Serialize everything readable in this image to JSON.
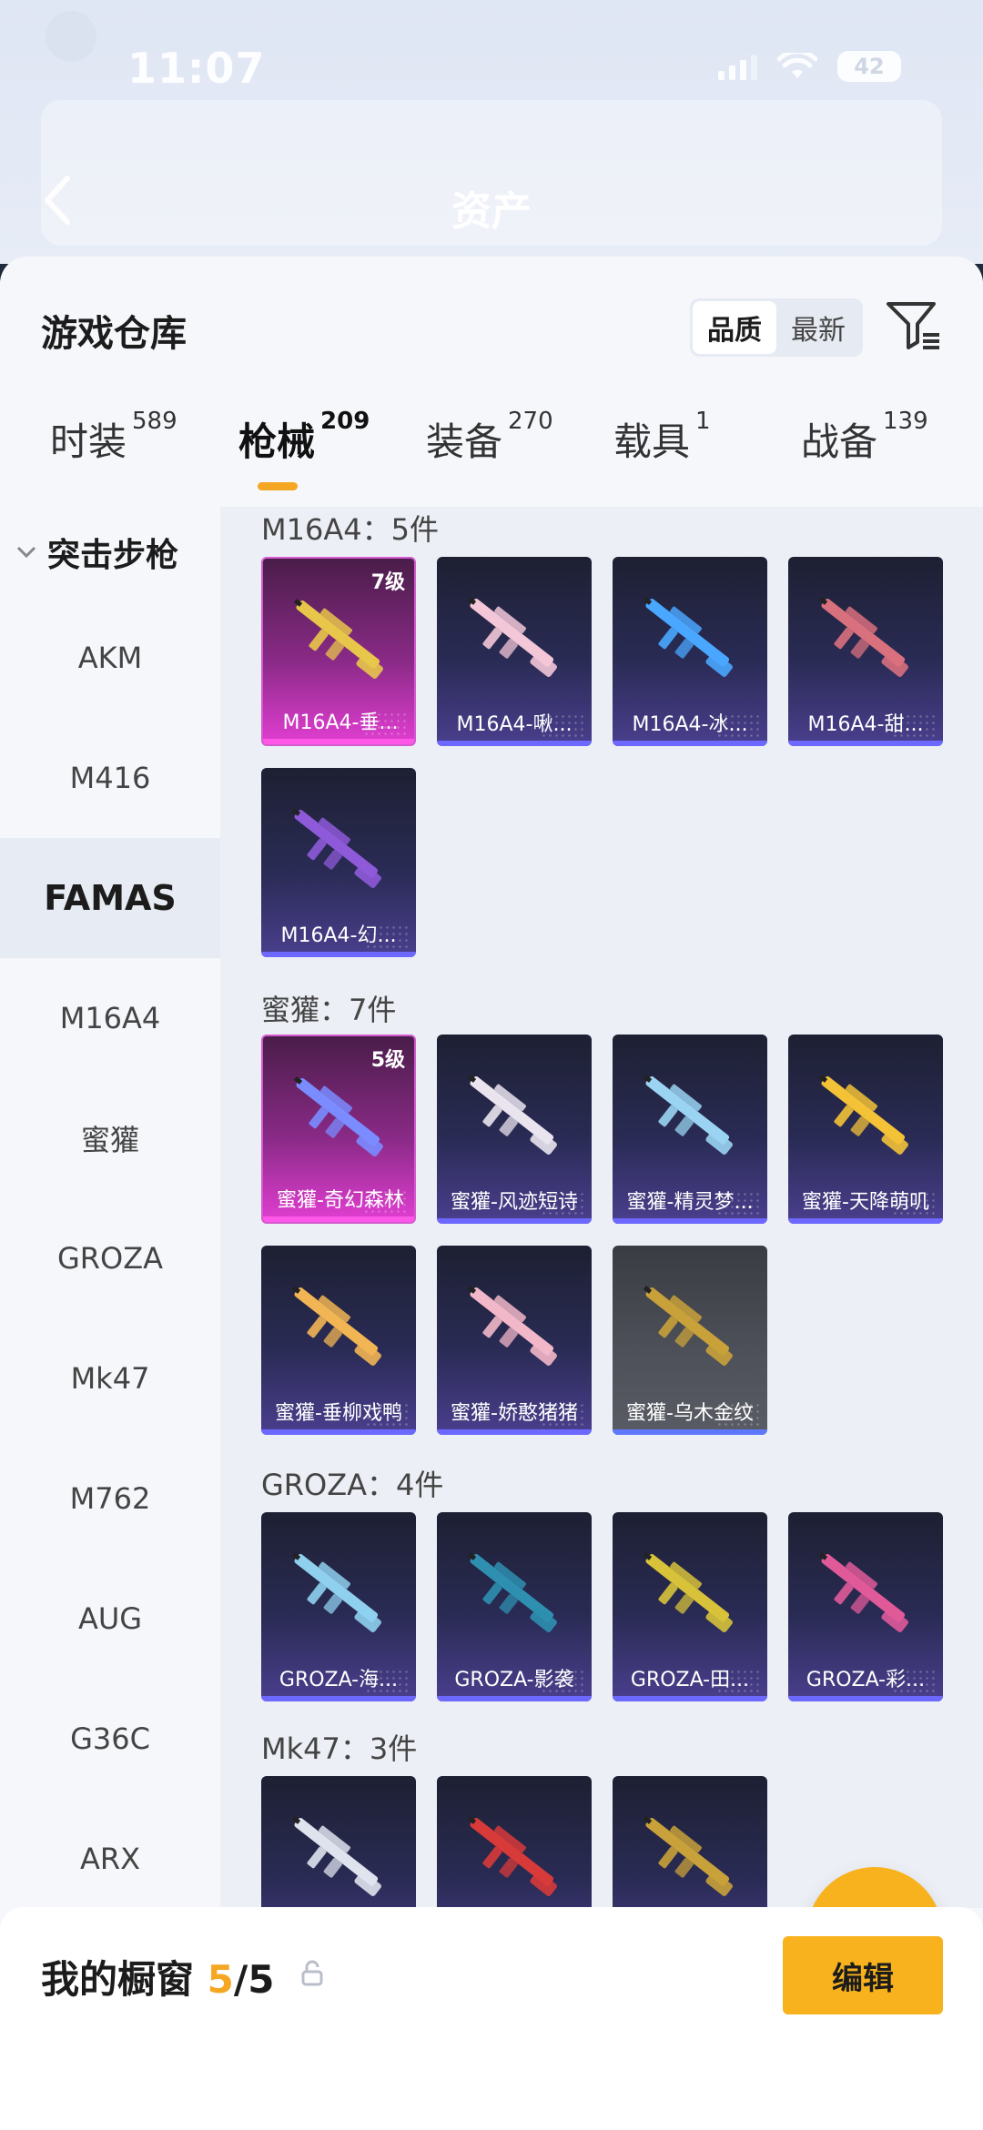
{
  "status": {
    "time": "11:07",
    "battery": "42"
  },
  "header": {
    "ghost_title": "资产"
  },
  "sheet": {
    "title": "游戏仓库",
    "sort_options": [
      "品质",
      "最新"
    ],
    "active_sort": "品质"
  },
  "tabs": [
    {
      "label": "时装",
      "count": "589"
    },
    {
      "label": "枪械",
      "count": "209"
    },
    {
      "label": "装备",
      "count": "270"
    },
    {
      "label": "载具",
      "count": "1"
    },
    {
      "label": "战备",
      "count": "139"
    }
  ],
  "active_tab": "枪械",
  "sidebar": {
    "group": "突击步枪",
    "items": [
      "AKM",
      "M416",
      "FAMAS",
      "M16A4",
      "蜜獾",
      "GROZA",
      "Mk47",
      "M762",
      "AUG",
      "G36C",
      "ARX"
    ],
    "active": "FAMAS"
  },
  "sections": [
    {
      "title": "M16A4：5件",
      "cards": [
        {
          "label": "M16A4-垂...",
          "level": "7级",
          "style": "pink",
          "gun_color": "#e8c64a"
        },
        {
          "label": "M16A4-啾...",
          "level": "",
          "style": "purple",
          "gun_color": "#f3c7d8"
        },
        {
          "label": "M16A4-冰...",
          "level": "",
          "style": "purple",
          "gun_color": "#4aa7ff"
        },
        {
          "label": "M16A4-甜...",
          "level": "",
          "style": "purple",
          "gun_color": "#d9707e"
        },
        {
          "label": "M16A4-幻...",
          "level": "",
          "style": "purple",
          "gun_color": "#8e5ad9"
        }
      ]
    },
    {
      "title": "蜜獾：7件",
      "cards": [
        {
          "label": "蜜獾-奇幻森林",
          "level": "5级",
          "style": "pink",
          "gun_color": "#7a8cff"
        },
        {
          "label": "蜜獾-风迹短诗",
          "level": "",
          "style": "purple",
          "gun_color": "#e9e4ee"
        },
        {
          "label": "蜜獾-精灵梦...",
          "level": "",
          "style": "purple",
          "gun_color": "#9ad4f2"
        },
        {
          "label": "蜜獾-天降萌叽",
          "level": "",
          "style": "purple",
          "gun_color": "#f3c237"
        },
        {
          "label": "蜜獾-垂柳戏鸭",
          "level": "",
          "style": "purple",
          "gun_color": "#f2b554"
        },
        {
          "label": "蜜獾-娇憨猪猪",
          "level": "",
          "style": "purple",
          "gun_color": "#f2b7c8"
        },
        {
          "label": "蜜獾-乌木金纹",
          "level": "",
          "style": "gray",
          "gun_color": "#c9a13a"
        }
      ]
    },
    {
      "title": "GROZA：4件",
      "cards": [
        {
          "label": "GROZA-海...",
          "level": "",
          "style": "purple",
          "gun_color": "#8fd0ef"
        },
        {
          "label": "GROZA-影袭",
          "level": "",
          "style": "purple",
          "gun_color": "#2e8fb0"
        },
        {
          "label": "GROZA-田...",
          "level": "",
          "style": "purple",
          "gun_color": "#d7c23a"
        },
        {
          "label": "GROZA-彩...",
          "level": "",
          "style": "purple",
          "gun_color": "#e05a9a"
        }
      ]
    },
    {
      "title": "Mk47：3件",
      "cards": [
        {
          "label": "",
          "level": "",
          "style": "purple",
          "gun_color": "#dfe3ee"
        },
        {
          "label": "",
          "level": "",
          "style": "purple",
          "gun_color": "#d83a3a"
        },
        {
          "label": "",
          "level": "",
          "style": "purple",
          "gun_color": "#c9a13a"
        }
      ]
    }
  ],
  "bottom": {
    "title": "我的橱窗",
    "current": "5",
    "total": "/5",
    "edit_label": "编辑"
  },
  "colors": {
    "accent": "#f7b21d",
    "underline": "#f5a623"
  }
}
